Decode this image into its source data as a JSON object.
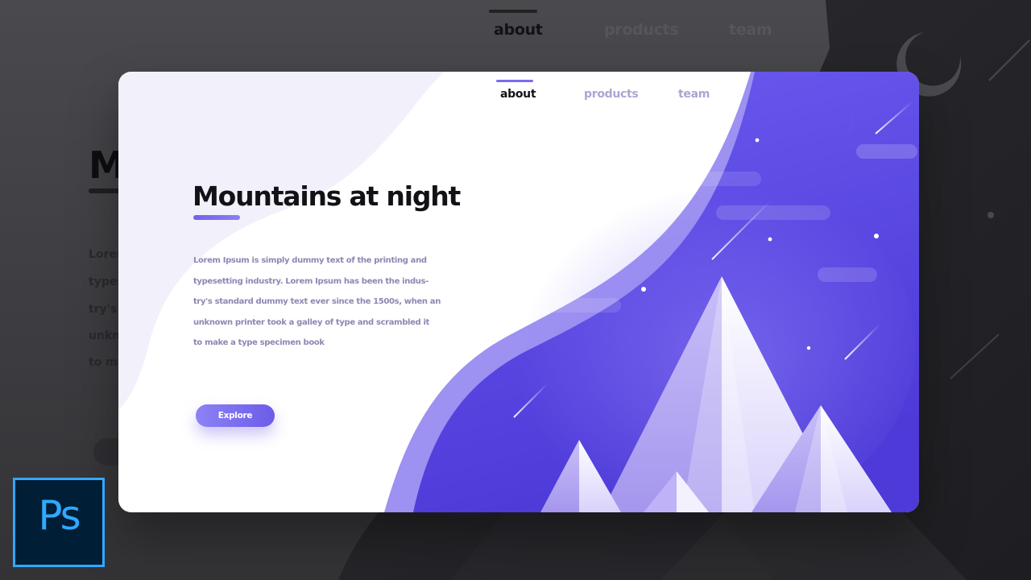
{
  "background_preview": {
    "nav": [
      "about",
      "products",
      "team"
    ],
    "heading_fragment": "M",
    "para_fragments": [
      "Lorem",
      "types",
      "try's s",
      "unkno",
      "to ma"
    ]
  },
  "card": {
    "nav": {
      "items": [
        {
          "label": "about",
          "active": true
        },
        {
          "label": "products",
          "active": false
        },
        {
          "label": "team",
          "active": false
        }
      ]
    },
    "hero": {
      "title": "Mountains at night",
      "lines": [
        "Lorem Ipsum is simply dummy text of the printing and",
        "typesetting industry. Lorem Ipsum has been the indus-",
        "try's standard dummy text ever since the 1500s, when an",
        "unknown printer took a galley of type and scrambled it",
        "to make a type specimen book"
      ],
      "button_label": "Explore"
    },
    "colors": {
      "accent": "#7161ee",
      "night_sky": "#5a48e2",
      "muted_text": "#8b88b4"
    }
  },
  "ps_badge": {
    "label": "Ps",
    "colors": {
      "bg": "#001e36",
      "fg": "#31a8ff"
    }
  }
}
